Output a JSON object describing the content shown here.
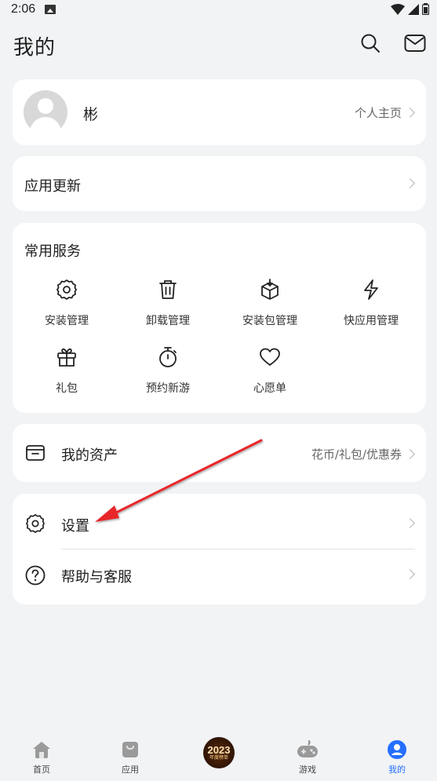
{
  "status": {
    "time": "2:06"
  },
  "header": {
    "title": "我的"
  },
  "profile": {
    "name": "彬",
    "home_link": "个人主页"
  },
  "update": {
    "label": "应用更新"
  },
  "services": {
    "title": "常用服务",
    "items": [
      {
        "label": "安装管理",
        "icon": "gear-icon"
      },
      {
        "label": "卸载管理",
        "icon": "trash-icon"
      },
      {
        "label": "安装包管理",
        "icon": "package-icon"
      },
      {
        "label": "快应用管理",
        "icon": "lightning-icon"
      },
      {
        "label": "礼包",
        "icon": "gift-icon"
      },
      {
        "label": "预约新游",
        "icon": "stopwatch-icon"
      },
      {
        "label": "心愿单",
        "icon": "heart-icon"
      }
    ]
  },
  "assets": {
    "label": "我的资产",
    "detail": "花币/礼包/优惠券"
  },
  "settings": {
    "label": "设置"
  },
  "help": {
    "label": "帮助与客服"
  },
  "tabbar": {
    "tabs": [
      {
        "label": "首页"
      },
      {
        "label": "应用"
      },
      {
        "label": "2023",
        "sub": "年度榜单"
      },
      {
        "label": "游戏"
      },
      {
        "label": "我的",
        "active": true
      }
    ]
  },
  "colors": {
    "accent": "#256fff",
    "annotation_arrow": "#e8282b",
    "background": "#f1f3f5"
  }
}
